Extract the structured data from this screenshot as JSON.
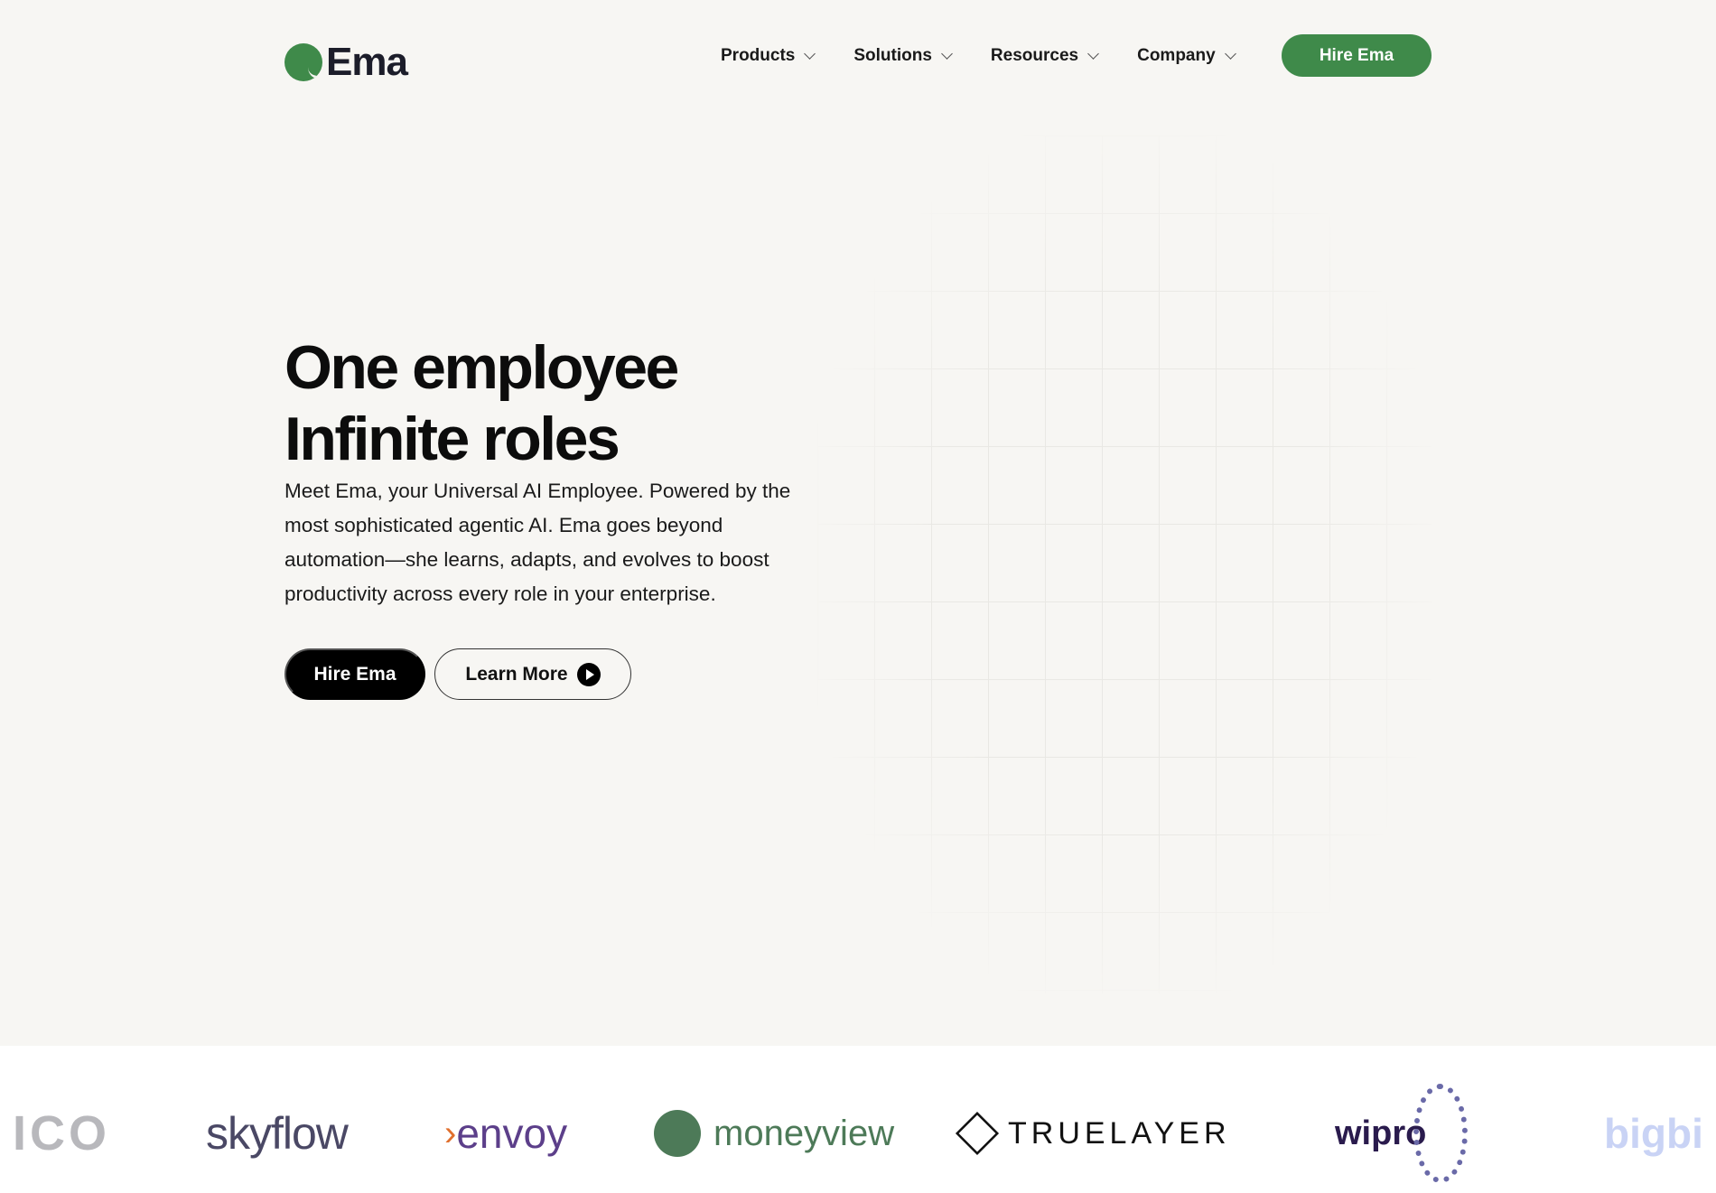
{
  "header": {
    "logo_text": "Ema",
    "nav": [
      {
        "label": "Products"
      },
      {
        "label": "Solutions"
      },
      {
        "label": "Resources"
      },
      {
        "label": "Company"
      }
    ],
    "cta": "Hire Ema"
  },
  "hero": {
    "title_line1": "One employee",
    "title_line2": "Infinite roles",
    "description": "Meet Ema, your Universal AI Employee. Powered by the most sophisticated agentic AI. Ema goes beyond automation—she learns, adapts, and evolves to boost productivity across every role in your enterprise.",
    "primary_button": "Hire Ema",
    "secondary_button": "Learn More"
  },
  "customers": {
    "logos": [
      "ICO",
      "skyflow",
      "envoy",
      "moneyview",
      "TRUELAYER",
      "wipro",
      "bigbi"
    ]
  },
  "colors": {
    "brand_green": "#3f8a4a",
    "background": "#f7f6f3"
  }
}
